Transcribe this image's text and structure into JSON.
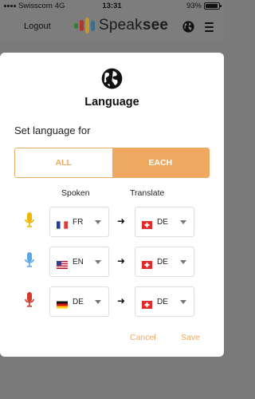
{
  "status_bar": {
    "carrier": "Swisscom",
    "network": "4G",
    "time": "13:31",
    "battery": "93%",
    "battery_level": 0.93
  },
  "header": {
    "logout_label": "Logout",
    "brand_regular": "Speak",
    "brand_bold": "see",
    "icons": [
      "globe-icon",
      "hamburger-icon"
    ]
  },
  "modal": {
    "title": "Language",
    "set_label": "Set language for",
    "segments": [
      {
        "label": "ALL",
        "selected": false
      },
      {
        "label": "EACH",
        "selected": true
      }
    ],
    "columns": {
      "spoken": "Spoken",
      "translate": "Translate"
    },
    "rows": [
      {
        "mic_color": "#f2b400",
        "spoken": {
          "flag": "fr",
          "code": "FR"
        },
        "translate": {
          "flag": "ch",
          "code": "DE"
        }
      },
      {
        "mic_color": "#5aa6e6",
        "spoken": {
          "flag": "us",
          "code": "EN"
        },
        "translate": {
          "flag": "ch",
          "code": "DE"
        }
      },
      {
        "mic_color": "#d33a2c",
        "spoken": {
          "flag": "de",
          "code": "DE"
        },
        "translate": {
          "flag": "ch",
          "code": "DE"
        }
      }
    ],
    "cancel_label": "Cancel",
    "save_label": "Save"
  },
  "colors": {
    "accent": "#efa860",
    "overlay": "#7a7a7a"
  }
}
